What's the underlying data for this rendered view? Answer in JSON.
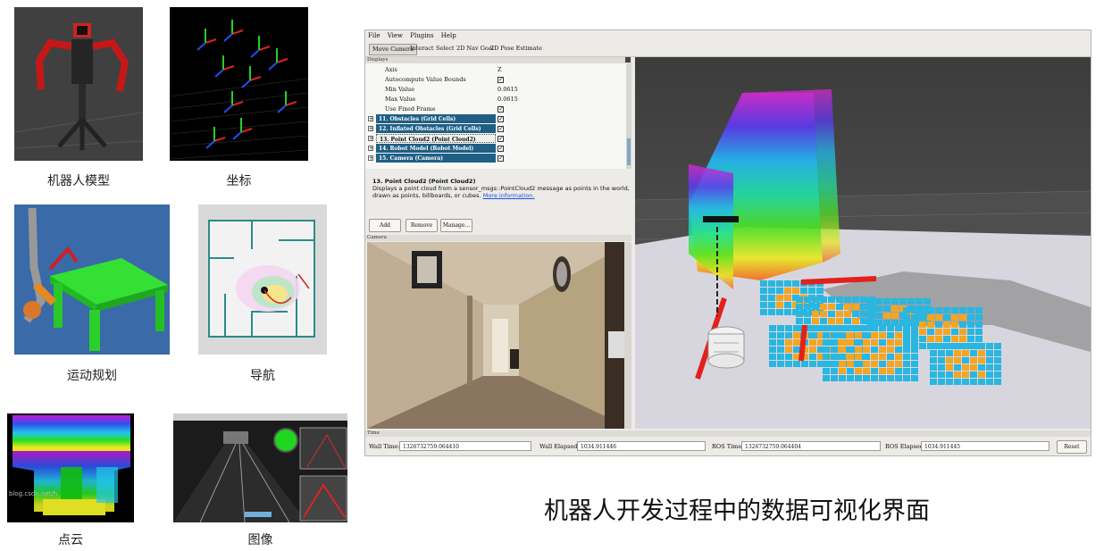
{
  "thumbnails": [
    {
      "id": "robot_model",
      "caption": "机器人模型"
    },
    {
      "id": "coordinates",
      "caption": "坐标"
    },
    {
      "id": "motion_planning",
      "caption": "运动规划"
    },
    {
      "id": "navigation",
      "caption": "导航"
    },
    {
      "id": "point_cloud",
      "caption": "点云",
      "watermark": "blog.csdn.net/h"
    },
    {
      "id": "image",
      "caption": "图像"
    }
  ],
  "main_caption": "机器人开发过程中的数据可视化界面",
  "rviz": {
    "menu": [
      "File",
      "View",
      "Plugins",
      "Help"
    ],
    "tools": [
      {
        "label": "Move Camera",
        "active": true
      },
      {
        "label": "Interact",
        "active": false
      },
      {
        "label": "Select",
        "active": false
      },
      {
        "label": "2D Nav Goal",
        "active": false
      },
      {
        "label": "2D Pose Estimate",
        "active": false
      }
    ],
    "displays_title": "Displays",
    "properties": [
      {
        "name": "Axis",
        "value": "Z",
        "checkbox": false
      },
      {
        "name": "Autocompute Value Bounds",
        "value": "",
        "checkbox": true
      },
      {
        "name": "Min Value",
        "value": "0.0615",
        "checkbox": false
      },
      {
        "name": "Max Value",
        "value": "0.0615",
        "checkbox": false
      },
      {
        "name": "Use Fixed Frame",
        "value": "",
        "checkbox": true
      }
    ],
    "displays": [
      {
        "label": "11. Obstacles (Grid Cells)",
        "selected": false
      },
      {
        "label": "12. Inflated Obstacles (Grid Cells)",
        "selected": false
      },
      {
        "label": "13. Point Cloud2 (Point Cloud2)",
        "selected": true
      },
      {
        "label": "14. Robot Model (Robot Model)",
        "selected": false
      },
      {
        "label": "15. Camera (Camera)",
        "selected": false
      }
    ],
    "description": {
      "title": "13. Point Cloud2 (Point Cloud2)",
      "text": "Displays a point cloud from a sensor_msgs::PointCloud2 message as points in the world, drawn as points, billboards, or cubes.",
      "link": "More information."
    },
    "buttons": {
      "add": "Add",
      "remove": "Remove",
      "manage": "Manage..."
    },
    "camera_title": "Camera",
    "time_title": "Time",
    "time": {
      "wall_time_label": "Wall Time:",
      "wall_time": "1326732759.064410",
      "wall_elapsed_label": "Wall Elapsed:",
      "wall_elapsed": "1034.911446",
      "ros_time_label": "ROS Time:",
      "ros_time": "1326732759.064404",
      "ros_elapsed_label": "ROS Elapsed:",
      "ros_elapsed": "1034.911445",
      "reset": "Reset"
    }
  },
  "colors": {
    "display_row": "#1f5f85",
    "nav_blue": "#29b6e0",
    "nav_orange": "#f2a623",
    "path_red": "#e2211c"
  }
}
